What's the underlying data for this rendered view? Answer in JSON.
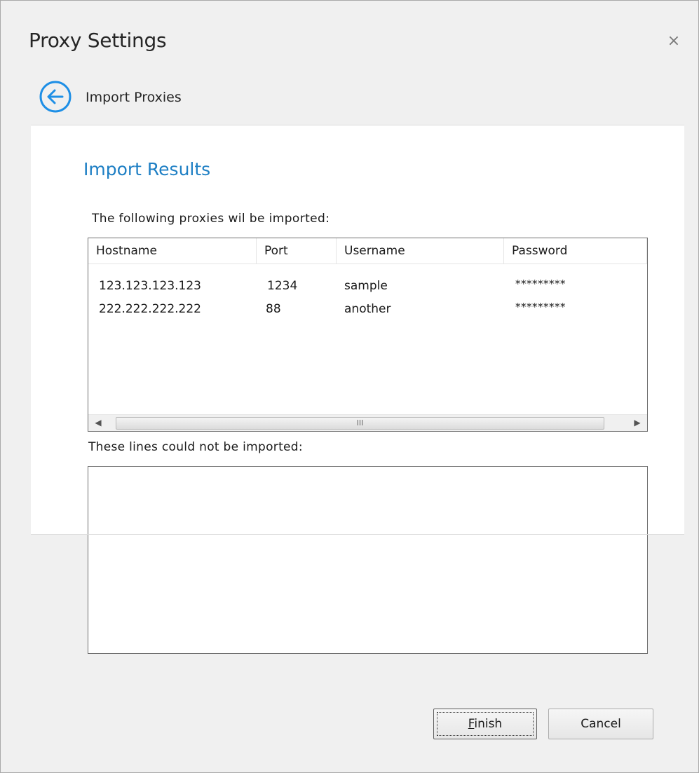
{
  "window": {
    "title": "Proxy Settings",
    "close_glyph": "×"
  },
  "nav": {
    "back_icon": "back-arrow-circle-icon",
    "step_label": "Import Proxies"
  },
  "content": {
    "heading": "Import Results",
    "imported_label": "The following proxies wil be imported:",
    "failed_label": "These lines could not be imported:",
    "failed_lines": []
  },
  "proxy_table": {
    "columns": [
      "Hostname",
      "Port",
      "Username",
      "Password"
    ],
    "rows": [
      {
        "hostname": "123.123.123.123",
        "port": "1234",
        "username": "sample",
        "password": "*********"
      },
      {
        "hostname": "222.222.222.222",
        "port": "88",
        "username": "another",
        "password": "*********"
      }
    ],
    "scrollbar_grip": "III"
  },
  "buttons": {
    "finish_mnemonic": "F",
    "finish_rest": "inish",
    "cancel": "Cancel"
  },
  "colors": {
    "accent": "#1e7fc4",
    "dialog_bg": "#f0f0f0"
  }
}
